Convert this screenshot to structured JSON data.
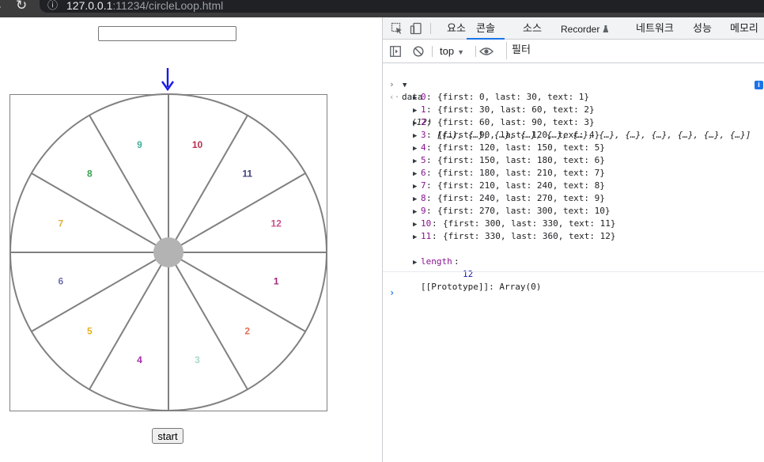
{
  "browser": {
    "url_host": "127.0.0.1",
    "url_rest": ":11234/circleLoop.html"
  },
  "page": {
    "input_value": "",
    "start_label": "start",
    "pointer_color": "#1a1ae6",
    "wheel": {
      "segment_count": 12,
      "hub_color": "#b3b3b3",
      "line_color": "#808080",
      "labels": [
        {
          "text": "1",
          "color": "#a0267a"
        },
        {
          "text": "2",
          "color": "#e0705a"
        },
        {
          "text": "3",
          "color": "#a8d8c8"
        },
        {
          "text": "4",
          "color": "#a82aa8"
        },
        {
          "text": "5",
          "color": "#e8b020"
        },
        {
          "text": "6",
          "color": "#7070b0"
        },
        {
          "text": "7",
          "color": "#e0b040"
        },
        {
          "text": "8",
          "color": "#3aa050"
        },
        {
          "text": "9",
          "color": "#40b0a0"
        },
        {
          "text": "10",
          "color": "#b83050"
        },
        {
          "text": "11",
          "color": "#404080"
        },
        {
          "text": "12",
          "color": "#c85090"
        }
      ]
    }
  },
  "devtools": {
    "tabs": [
      {
        "label": "요소",
        "active": false
      },
      {
        "label": "콘솔",
        "active": true
      },
      {
        "label": "소스",
        "active": false
      },
      {
        "label": "Recorder",
        "active": false
      },
      {
        "label": "네트워크",
        "active": false
      },
      {
        "label": "성능",
        "active": false
      },
      {
        "label": "메모리",
        "active": false
      }
    ],
    "context": "top",
    "filter_placeholder": "필터",
    "console": {
      "input_cmd": "data",
      "summary_count": "(12)",
      "summary_items": "[{…}, {…}, {…}, {…}, {…}, {…}, {…}, {…}, {…}, {…}, {…}, {…}]",
      "info_badge": "i",
      "entries": [
        {
          "index": "0",
          "body": "{first: 0, last: 30, text: 1}"
        },
        {
          "index": "1",
          "body": "{first: 30, last: 60, text: 2}"
        },
        {
          "index": "2",
          "body": "{first: 60, last: 90, text: 3}"
        },
        {
          "index": "3",
          "body": "{first: 90, last: 120, text: 4}"
        },
        {
          "index": "4",
          "body": "{first: 120, last: 150, text: 5}"
        },
        {
          "index": "5",
          "body": "{first: 150, last: 180, text: 6}"
        },
        {
          "index": "6",
          "body": "{first: 180, last: 210, text: 7}"
        },
        {
          "index": "7",
          "body": "{first: 210, last: 240, text: 8}"
        },
        {
          "index": "8",
          "body": "{first: 240, last: 270, text: 9}"
        },
        {
          "index": "9",
          "body": "{first: 270, last: 300, text: 10}"
        },
        {
          "index": "10",
          "body": "{first: 300, last: 330, text: 11}"
        },
        {
          "index": "11",
          "body": "{first: 330, last: 360, text: 12}"
        }
      ],
      "length_key": "length",
      "length_value": "12",
      "prototype": "[[Prototype]]: Array(0)"
    }
  }
}
